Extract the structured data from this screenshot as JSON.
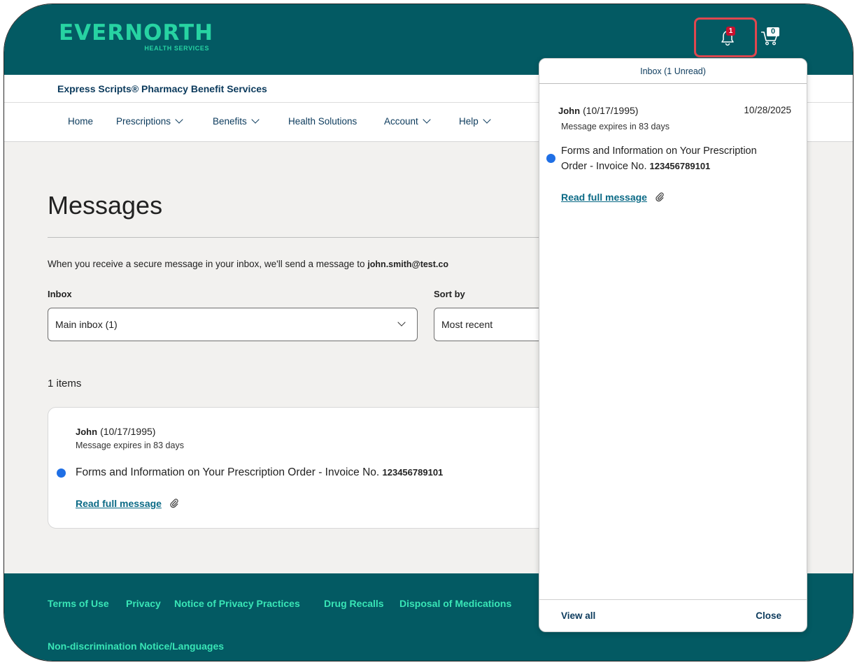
{
  "header": {
    "logo_main": "EVERNORTH",
    "logo_sub": "HEALTH SERVICES",
    "notification_count": "1",
    "cart_count": "0"
  },
  "subbar": {
    "title": "Express Scripts® Pharmacy Benefit Services"
  },
  "nav": {
    "home": "Home",
    "prescriptions": "Prescriptions",
    "benefits": "Benefits",
    "health_solutions": "Health Solutions",
    "account": "Account",
    "help": "Help"
  },
  "main": {
    "title": "Messages",
    "notice_text": "When you receive a secure message in your inbox, we'll send a message to ",
    "notice_email": "john.smith@test.co",
    "inbox_label": "Inbox",
    "inbox_value": "Main inbox (1)",
    "sort_label": "Sort by",
    "sort_value": "Most recent",
    "items_count": "1 items"
  },
  "card": {
    "from_name": "John",
    "from_dob": "(10/17/1995)",
    "expires": "Message expires in 83 days",
    "subject": "Forms and Information on Your Prescription Order - Invoice No. ",
    "invoice": "123456789101",
    "read_link": "Read full message"
  },
  "panel": {
    "header": "Inbox (1 Unread)",
    "from_name": "John",
    "from_dob": "(10/17/1995)",
    "date": "10/28/2025",
    "expires": "Message expires in 83 days",
    "subject_line1": "Forms and Information on Your Prescription",
    "subject_line2": "Order - Invoice No. ",
    "invoice": "123456789101",
    "read_link": "Read full message",
    "view_all": "View all",
    "close": "Close"
  },
  "footer": {
    "links": [
      "Terms of Use",
      "Privacy",
      "Notice of Privacy Practices",
      "Drug Recalls",
      "Disposal of Medications"
    ],
    "link2": "Non-discrimination Notice/Languages"
  },
  "colors": {
    "brand_teal": "#035a63",
    "accent_green": "#27d3a2",
    "highlight_red": "#e0474f",
    "unread_dot": "#1f6fe5"
  },
  "icons": [
    "bell-icon",
    "cart-icon",
    "chevron-down-icon",
    "paperclip-icon",
    "unread-dot-icon"
  ]
}
